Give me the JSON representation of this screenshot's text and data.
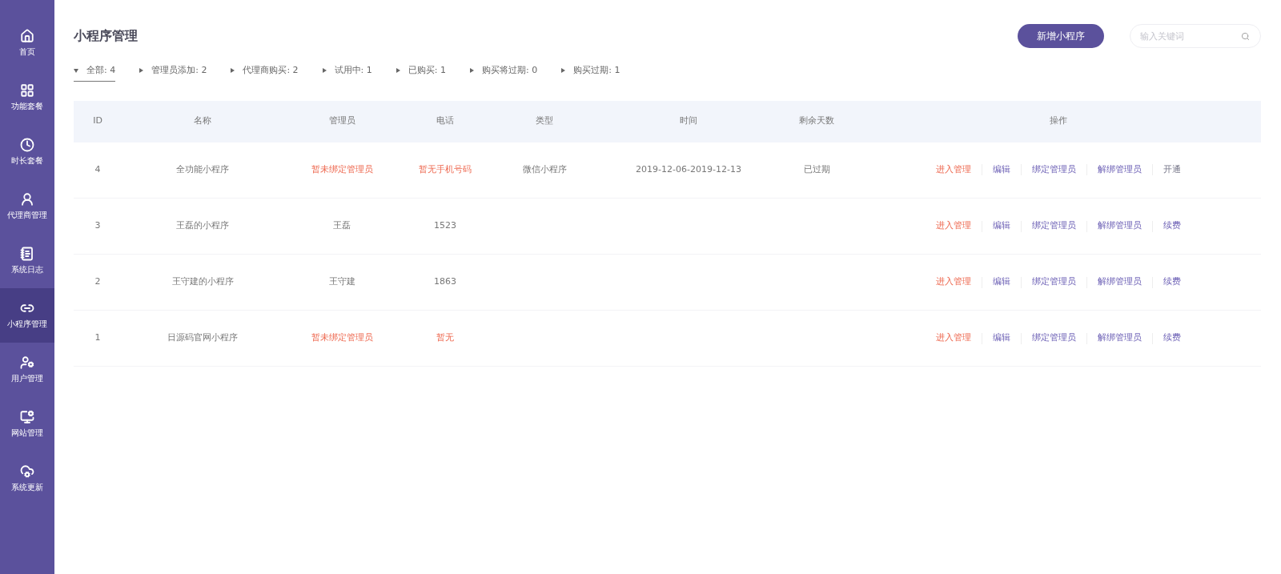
{
  "sidebar": {
    "items": [
      {
        "label": "首页",
        "selected": false
      },
      {
        "label": "功能套餐",
        "selected": false
      },
      {
        "label": "时长套餐",
        "selected": false
      },
      {
        "label": "代理商管理",
        "selected": false
      },
      {
        "label": "系统日志",
        "selected": false
      },
      {
        "label": "小程序管理",
        "selected": true
      },
      {
        "label": "用户管理",
        "selected": false
      },
      {
        "label": "网站管理",
        "selected": false
      },
      {
        "label": "系统更新",
        "selected": false
      }
    ]
  },
  "page": {
    "title": "小程序管理",
    "add_button": "新增小程序",
    "search": {
      "placeholder": "输入关键词"
    }
  },
  "filters": [
    {
      "label": "全部: 4",
      "selected": true
    },
    {
      "label": "管理员添加: 2",
      "selected": false
    },
    {
      "label": "代理商购买: 2",
      "selected": false
    },
    {
      "label": "试用中: 1",
      "selected": false
    },
    {
      "label": "已购买: 1",
      "selected": false
    },
    {
      "label": "购买将过期: 0",
      "selected": false
    },
    {
      "label": "购买过期: 1",
      "selected": false
    }
  ],
  "table": {
    "columns": [
      "ID",
      "名称",
      "管理员",
      "电话",
      "类型",
      "时间",
      "剩余天数",
      "操作"
    ],
    "rows": [
      {
        "id": "4",
        "name": "全功能小程序",
        "admin": "暂未绑定管理员",
        "admin_missing": true,
        "phone": "暂无手机号码",
        "phone_missing": true,
        "type": "微信小程序",
        "time": "2019-12-06-2019-12-13",
        "remaining": "已过期",
        "actions": [
          {
            "label": "进入管理",
            "kind": "primary"
          },
          {
            "label": "编辑",
            "kind": "normal"
          },
          {
            "label": "绑定管理员",
            "kind": "normal"
          },
          {
            "label": "解绑管理员",
            "kind": "normal"
          },
          {
            "label": "开通",
            "kind": "muted"
          }
        ]
      },
      {
        "id": "3",
        "name": "王磊的小程序",
        "admin": "王磊",
        "admin_missing": false,
        "phone": "1523",
        "phone_missing": false,
        "actions": [
          {
            "label": "进入管理",
            "kind": "primary"
          },
          {
            "label": "编辑",
            "kind": "normal"
          },
          {
            "label": "绑定管理员",
            "kind": "normal"
          },
          {
            "label": "解绑管理员",
            "kind": "normal"
          },
          {
            "label": "续费",
            "kind": "normal"
          }
        ]
      },
      {
        "id": "2",
        "name": "王守建的小程序",
        "admin": "王守建",
        "admin_missing": false,
        "phone": "1863",
        "phone_missing": false,
        "actions": [
          {
            "label": "进入管理",
            "kind": "primary"
          },
          {
            "label": "编辑",
            "kind": "normal"
          },
          {
            "label": "绑定管理员",
            "kind": "normal"
          },
          {
            "label": "解绑管理员",
            "kind": "normal"
          },
          {
            "label": "续费",
            "kind": "normal"
          }
        ]
      },
      {
        "id": "1",
        "name": "日源码官网小程序",
        "admin": "暂未绑定管理员",
        "admin_missing": true,
        "phone": "暂无",
        "phone_missing": true,
        "actions": [
          {
            "label": "进入管理",
            "kind": "primary"
          },
          {
            "label": "编辑",
            "kind": "normal"
          },
          {
            "label": "绑定管理员",
            "kind": "normal"
          },
          {
            "label": "解绑管理员",
            "kind": "normal"
          },
          {
            "label": "续费",
            "kind": "normal"
          }
        ]
      }
    ]
  }
}
